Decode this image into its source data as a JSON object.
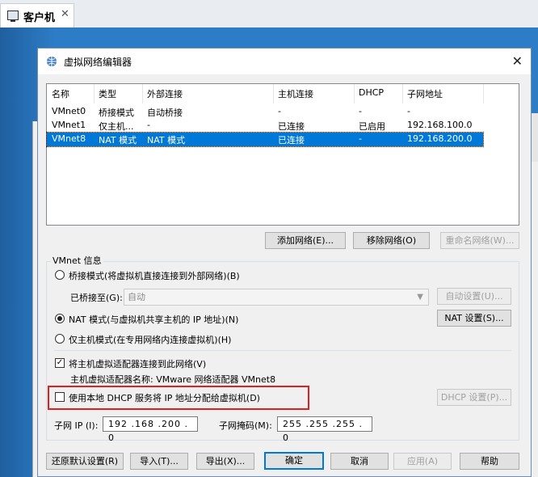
{
  "tab": {
    "label": "客户机",
    "close": "✕"
  },
  "dialog": {
    "title": "虚拟网络编辑器",
    "close": "✕"
  },
  "table": {
    "headers": [
      "名称",
      "类型",
      "外部连接",
      "主机连接",
      "DHCP",
      "子网地址"
    ],
    "rows": [
      [
        "VMnet0",
        "桥接模式",
        "自动桥接",
        "-",
        "-",
        "-"
      ],
      [
        "VMnet1",
        "仅主机...",
        "-",
        "已连接",
        "已启用",
        "192.168.100.0"
      ],
      [
        "VMnet8",
        "NAT 模式",
        "NAT 模式",
        "已连接",
        "-",
        "192.168.200.0"
      ]
    ]
  },
  "list_buttons": {
    "add": "添加网络(E)...",
    "remove": "移除网络(O)",
    "rename": "重命名网络(W)..."
  },
  "vmnet_info": {
    "label": "VMnet 信息",
    "bridged": "桥接模式(将虚拟机直接连接到外部网络)(B)",
    "bridged_to_label": "已桥接至(G):",
    "bridged_to_value": "自动",
    "auto_settings": "自动设置(U)...",
    "nat": "NAT 模式(与虚拟机共享主机的 IP 地址)(N)",
    "nat_settings": "NAT 设置(S)...",
    "host_only": "仅主机模式(在专用网络内连接虚拟机)(H)",
    "connect_adapter": "将主机虚拟适配器连接到此网络(V)",
    "adapter_name": "主机虚拟适配器名称: VMware 网络适配器 VMnet8",
    "use_dhcp": "使用本地 DHCP 服务将 IP 地址分配给虚拟机(D)",
    "dhcp_settings": "DHCP 设置(P)...",
    "subnet_ip_label": "子网 IP (I):",
    "subnet_ip": "192 .168 .200 . 0",
    "subnet_mask_label": "子网掩码(M):",
    "subnet_mask": "255 .255 .255 . 0"
  },
  "footer": {
    "restore": "还原默认设置(R)",
    "import": "导入(T)...",
    "export": "导出(X)...",
    "ok": "确定",
    "cancel": "取消",
    "apply": "应用(A)",
    "help": "帮助"
  },
  "state": {
    "selected_row": "VMnet8",
    "mode": "nat",
    "connect_adapter_checked": true,
    "use_dhcp_checked": false
  },
  "colors": {
    "selection": "#0078d7",
    "highlight_box": "#e02020"
  }
}
